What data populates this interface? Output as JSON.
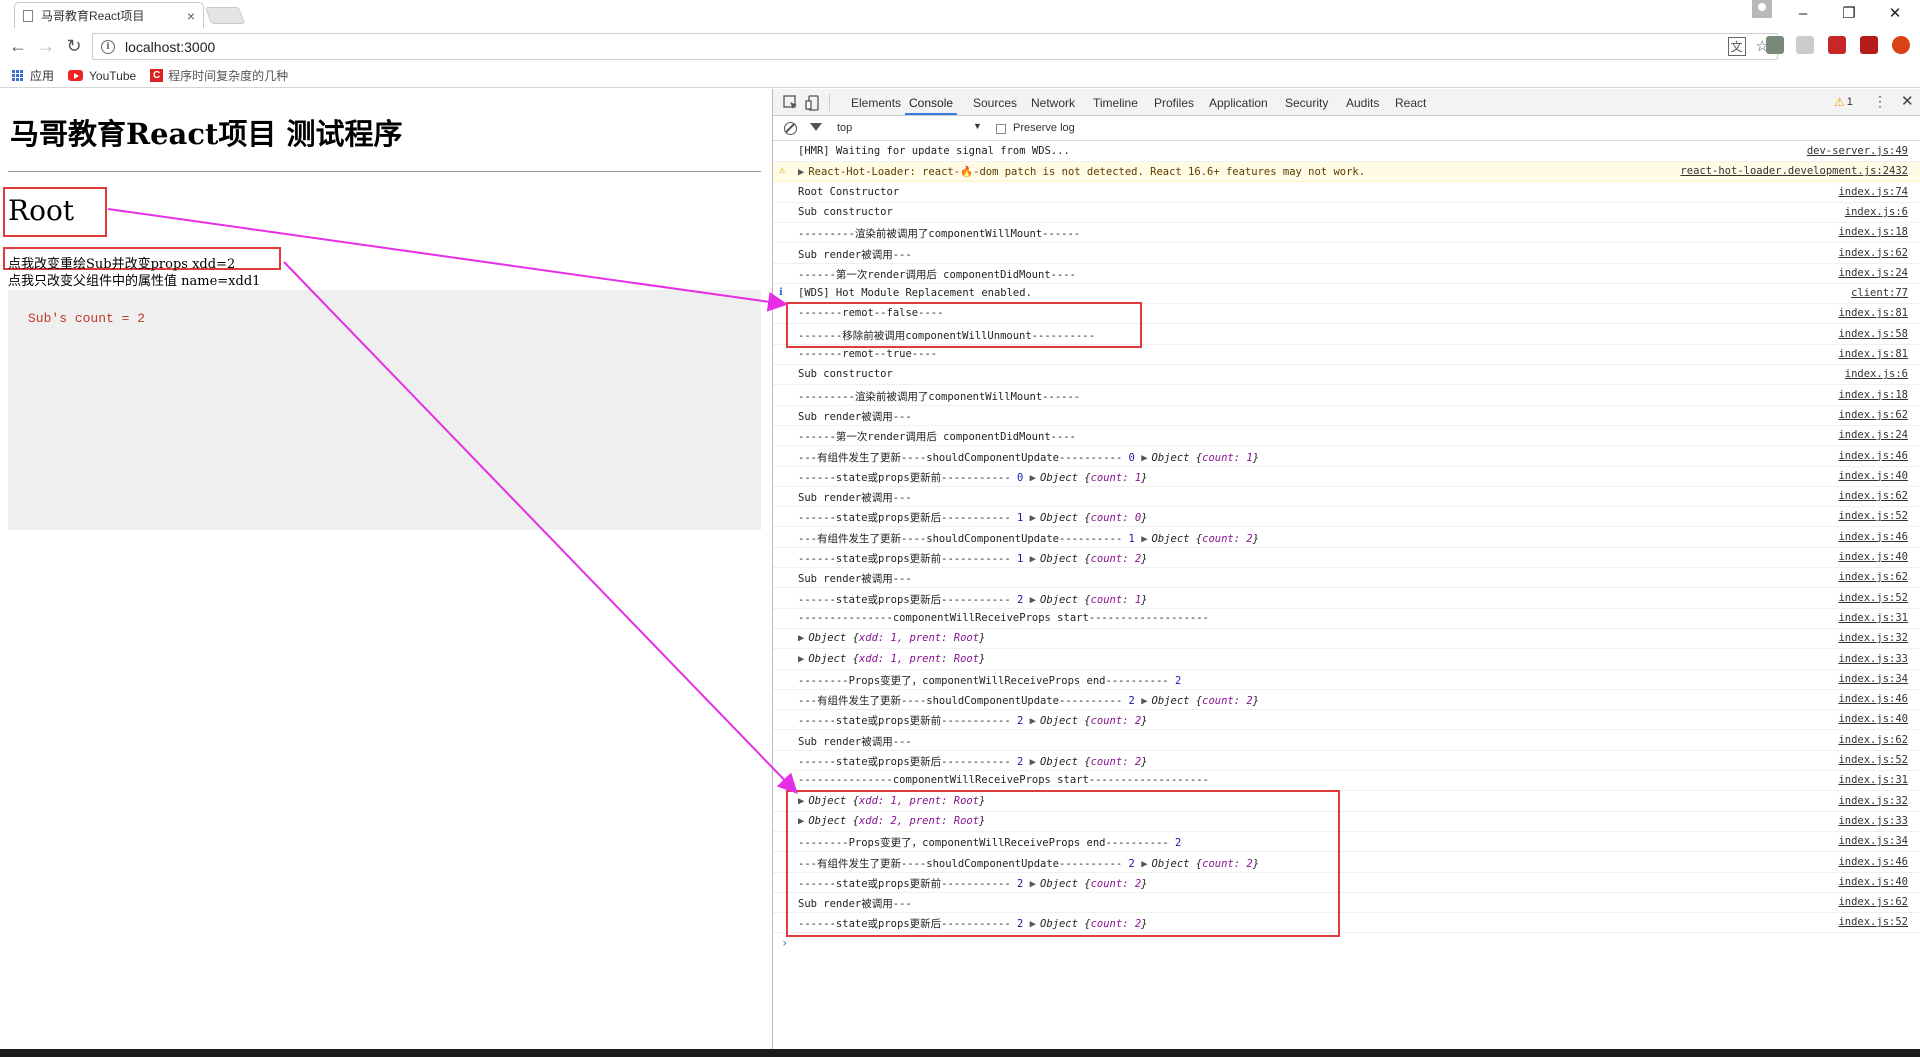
{
  "browser": {
    "tab_title": "马哥教育React项目",
    "tab_close": "×",
    "win_minimize": "–",
    "win_restore": "❐",
    "win_close": "✕",
    "url": "localhost:3000",
    "bookmarks": [
      {
        "label": "应用"
      },
      {
        "label": "YouTube"
      },
      {
        "label": "程序时间复杂度的几种"
      }
    ]
  },
  "page": {
    "title": "马哥教育React项目 测试程序",
    "root_label": "Root",
    "link_change_props": "点我改变重绘Sub并改变props xdd=2",
    "link_change_attr": "点我只改变父组件中的属性值 name=xdd1",
    "sub_count": "Sub's count = 2"
  },
  "devtools": {
    "tabs": [
      "Elements",
      "Console",
      "Sources",
      "Network",
      "Timeline",
      "Profiles",
      "Application",
      "Security",
      "Audits",
      "React"
    ],
    "active_tab": "Console",
    "warning_count": "1",
    "context": "top",
    "preserve_log": "Preserve log",
    "console": [
      {
        "msg": "[HMR] Waiting for update signal from WDS...",
        "src": "dev-server.js:49"
      },
      {
        "msg": "React-Hot-Loader: react-🔥-dom patch is not detected. React 16.6+ features may not work.",
        "src": "react-hot-loader.development.js:2432",
        "level": "warn"
      },
      {
        "msg": "Root Constructor",
        "src": "index.js:74"
      },
      {
        "msg": "Sub constructor",
        "src": "index.js:6"
      },
      {
        "msg": "---------渲染前被调用了componentWillMount------",
        "src": "index.js:18"
      },
      {
        "msg": "Sub render被调用---",
        "src": "index.js:62"
      },
      {
        "msg": "------第一次render调用后 componentDidMount----",
        "src": "index.js:24"
      },
      {
        "msg": "[WDS] Hot Module Replacement enabled.",
        "src": "client:77",
        "level": "info"
      },
      {
        "msg": "-------remot--false----",
        "src": "index.js:81"
      },
      {
        "msg": "-------移除前被调用componentWillUnmount----------",
        "src": "index.js:58"
      },
      {
        "msg": "-------remot--true----",
        "src": "index.js:81"
      },
      {
        "msg": "Sub constructor",
        "src": "index.js:6"
      },
      {
        "msg": "---------渲染前被调用了componentWillMount------",
        "src": "index.js:18"
      },
      {
        "msg": "Sub render被调用---",
        "src": "index.js:62"
      },
      {
        "msg": "------第一次render调用后 componentDidMount----",
        "src": "index.js:24"
      },
      {
        "msg": "---有组件发生了更新----shouldComponentUpdate---------- ",
        "num": "0",
        "obj": "count: 1",
        "src": "index.js:46"
      },
      {
        "msg": "------state或props更新前----------- ",
        "num": "0",
        "obj": "count: 1",
        "src": "index.js:40"
      },
      {
        "msg": "Sub render被调用---",
        "src": "index.js:62"
      },
      {
        "msg": "------state或props更新后----------- ",
        "num": "1",
        "obj": "count: 0",
        "src": "index.js:52"
      },
      {
        "msg": "---有组件发生了更新----shouldComponentUpdate---------- ",
        "num": "1",
        "obj": "count: 2",
        "src": "index.js:46"
      },
      {
        "msg": "------state或props更新前----------- ",
        "num": "1",
        "obj": "count: 2",
        "src": "index.js:40"
      },
      {
        "msg": "Sub render被调用---",
        "src": "index.js:62"
      },
      {
        "msg": "------state或props更新后----------- ",
        "num": "2",
        "obj": "count: 1",
        "src": "index.js:52"
      },
      {
        "msg": "---------------componentWillReceiveProps start-------------------",
        "src": "index.js:31"
      },
      {
        "msg": "",
        "expand": true,
        "obj": "xdd: 1, prent: Root",
        "src": "index.js:32"
      },
      {
        "msg": "",
        "expand": true,
        "obj": "xdd: 1, prent: Root",
        "src": "index.js:33"
      },
      {
        "msg": "--------Props变更了，componentWillReceiveProps end---------- ",
        "num": "2",
        "src": "index.js:34"
      },
      {
        "msg": "---有组件发生了更新----shouldComponentUpdate---------- ",
        "num": "2",
        "obj": "count: 2",
        "src": "index.js:46"
      },
      {
        "msg": "------state或props更新前----------- ",
        "num": "2",
        "obj": "count: 2",
        "src": "index.js:40"
      },
      {
        "msg": "Sub render被调用---",
        "src": "index.js:62"
      },
      {
        "msg": "------state或props更新后----------- ",
        "num": "2",
        "obj": "count: 2",
        "src": "index.js:52"
      },
      {
        "msg": "---------------componentWillReceiveProps start-------------------",
        "src": "index.js:31"
      },
      {
        "msg": "",
        "expand": true,
        "obj": "xdd: 1, prent: Root",
        "src": "index.js:32"
      },
      {
        "msg": "",
        "expand": true,
        "obj": "xdd: 2, prent: Root",
        "src": "index.js:33"
      },
      {
        "msg": "--------Props变更了，componentWillReceiveProps end---------- ",
        "num": "2",
        "src": "index.js:34"
      },
      {
        "msg": "---有组件发生了更新----shouldComponentUpdate---------- ",
        "num": "2",
        "obj": "count: 2",
        "src": "index.js:46"
      },
      {
        "msg": "------state或props更新前----------- ",
        "num": "2",
        "obj": "count: 2",
        "src": "index.js:40"
      },
      {
        "msg": "Sub render被调用---",
        "src": "index.js:62"
      },
      {
        "msg": "------state或props更新后----------- ",
        "num": "2",
        "obj": "count: 2",
        "src": "index.js:52"
      }
    ],
    "object_prefix": "Object"
  },
  "colors": {
    "highlight_box": "#e03a3a",
    "annotation_arrow": "#e62ee6",
    "active_tab_underline": "#3a7be0"
  }
}
